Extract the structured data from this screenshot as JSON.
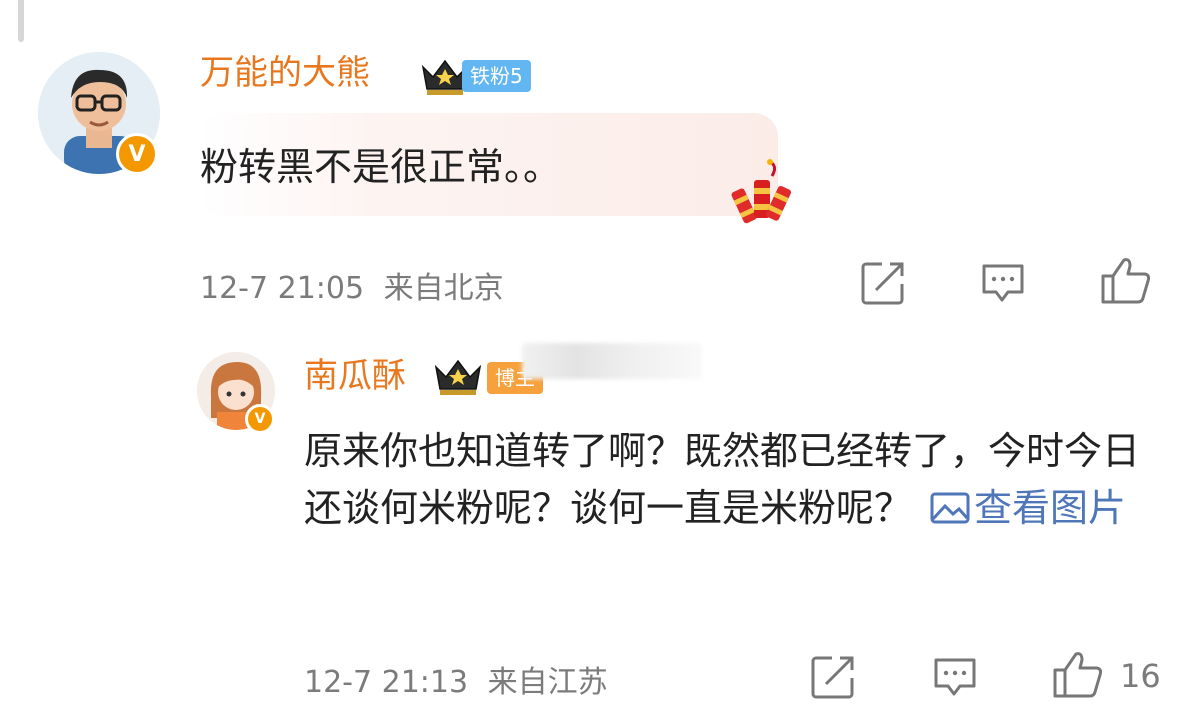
{
  "comment": {
    "username": "万能的大熊",
    "fan_tag": "铁粉5",
    "text": "粉转黑不是很正常。。",
    "time": "12-7 21:05",
    "location": "来自北京",
    "icons": [
      "crown-icon",
      "repost-icon",
      "comment-icon",
      "like-icon",
      "firecracker-icon"
    ]
  },
  "reply": {
    "username": "南瓜酥",
    "role_tag": "博主",
    "text": "原来你也知道转了啊？既然都已经转了，今时今日还谈何米粉呢？谈何一直是米粉呢？",
    "view_image": "查看图片",
    "time": "12-7 21:13",
    "location": "来自江苏",
    "like_count": "16"
  },
  "colors": {
    "username": "#e8781f",
    "link": "#4e76b8",
    "meta": "#7b7b7b",
    "fan_tag": "#62b6f2",
    "boss_tag": "#f6a13c",
    "verified": "#f39800"
  }
}
